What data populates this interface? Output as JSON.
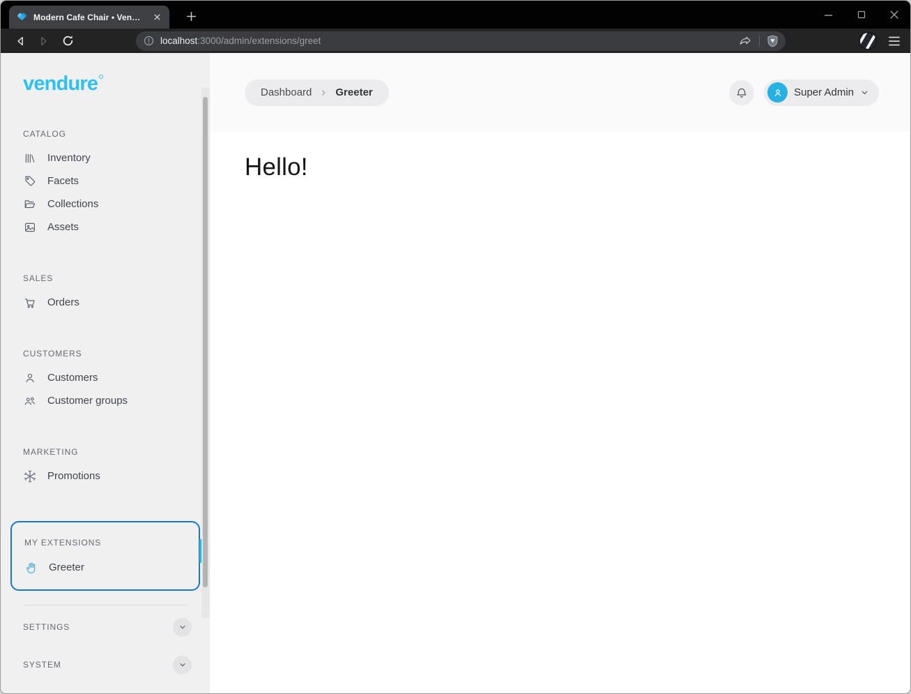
{
  "browser": {
    "tab": {
      "title": "Modern Cafe Chair • Vendure"
    },
    "url": {
      "host": "localhost",
      "path": ":3000/admin/extensions/greet"
    }
  },
  "sidebar": {
    "logo": "vendure",
    "sections": [
      {
        "label": "CATALOG",
        "items": [
          {
            "label": "Inventory"
          },
          {
            "label": "Facets"
          },
          {
            "label": "Collections"
          },
          {
            "label": "Assets"
          }
        ]
      },
      {
        "label": "SALES",
        "items": [
          {
            "label": "Orders"
          }
        ]
      },
      {
        "label": "CUSTOMERS",
        "items": [
          {
            "label": "Customers"
          },
          {
            "label": "Customer groups"
          }
        ]
      },
      {
        "label": "MARKETING",
        "items": [
          {
            "label": "Promotions"
          }
        ]
      },
      {
        "label": "MY EXTENSIONS",
        "items": [
          {
            "label": "Greeter"
          }
        ]
      }
    ],
    "collapsed_sections": [
      {
        "label": "SETTINGS"
      },
      {
        "label": "SYSTEM"
      }
    ]
  },
  "header": {
    "breadcrumb": {
      "root": "Dashboard",
      "current": "Greeter"
    },
    "user_name": "Super Admin"
  },
  "content": {
    "heading": "Hello!"
  },
  "colors": {
    "brand_accent": "#2ec0f0",
    "extension_highlight_border": "#1478d2",
    "active_indicator": "#2cb1ea",
    "avatar_bg": "#25b2e2"
  }
}
